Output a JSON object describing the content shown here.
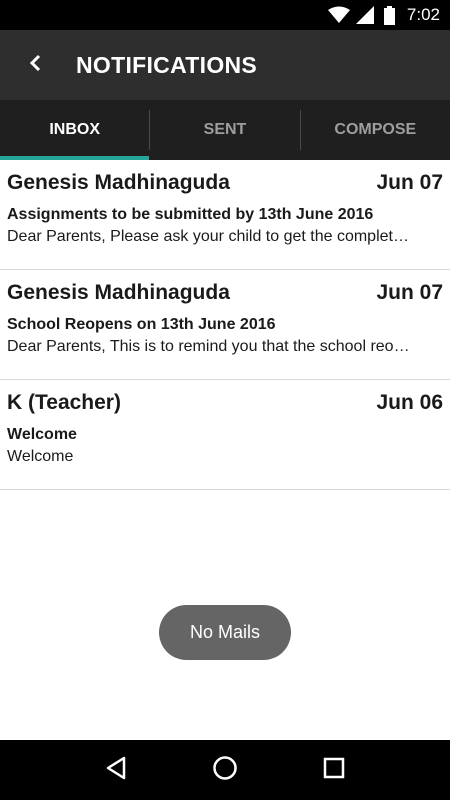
{
  "status_bar": {
    "time": "7:02",
    "icons": [
      "wifi-icon",
      "cell-signal-icon",
      "battery-icon"
    ]
  },
  "app_bar": {
    "back_icon": "chevron-left-icon",
    "title": "NOTIFICATIONS"
  },
  "tabs": [
    {
      "label": "INBOX",
      "active": true
    },
    {
      "label": "SENT",
      "active": false
    },
    {
      "label": "COMPOSE",
      "active": false
    }
  ],
  "mails": [
    {
      "sender": "Genesis Madhinaguda",
      "date": "Jun 07",
      "subject": "Assignments to be submitted by 13th June 2016",
      "preview": "Dear Parents,  Please ask your child to get the complet…"
    },
    {
      "sender": "Genesis Madhinaguda",
      "date": "Jun 07",
      "subject": "School Reopens on 13th June 2016",
      "preview": "Dear Parents, This is to remind you that the school reo…"
    },
    {
      "sender": "K (Teacher)",
      "date": "Jun 06",
      "subject": "Welcome",
      "preview": "Welcome"
    }
  ],
  "toast": {
    "text": "No Mails"
  },
  "nav_bar": {
    "icons": [
      "back-triangle-icon",
      "home-circle-icon",
      "recents-square-icon"
    ]
  },
  "colors": {
    "tab_indicator": "#26a69a",
    "app_bar": "#2e2e2e",
    "tab_bar": "#1f1f1f",
    "toast": "#656565"
  }
}
